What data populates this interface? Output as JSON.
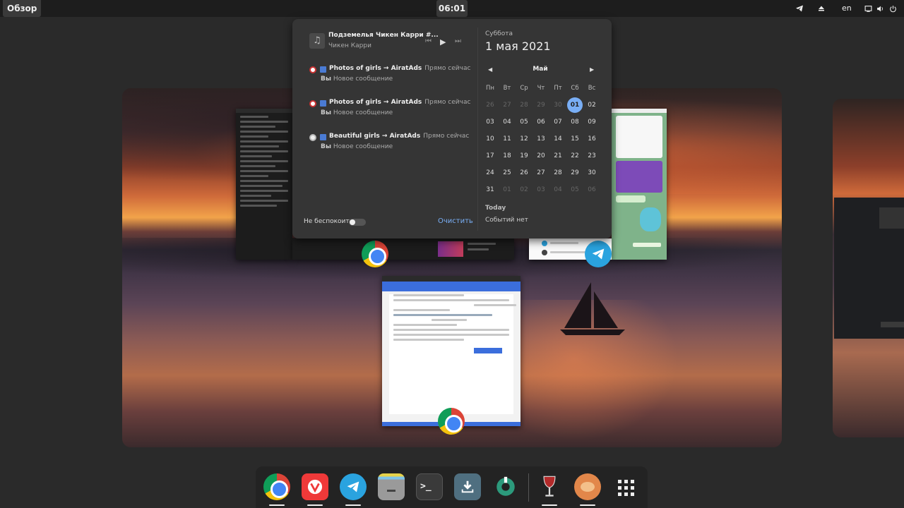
{
  "topbar": {
    "overview_label": "Обзор",
    "clock": "06:01",
    "keyboard_layout": "en"
  },
  "media": {
    "track_title": "Подземелья Чикен Карри #...",
    "artist": "Чикен Карри",
    "prev_icon": "skip-back-icon",
    "play_icon": "play-icon",
    "next_icon": "skip-forward-icon"
  },
  "notifications": [
    {
      "title": "Photos of girls → AiratAds",
      "time": "Прямо сейчас",
      "sender": "Вы",
      "body": "Новое сообщение"
    },
    {
      "title": "Photos of girls → AiratAds",
      "time": "Прямо сейчас",
      "sender": "Вы",
      "body": "Новое сообщение"
    },
    {
      "title": "Beautiful girls → AiratAds",
      "time": "Прямо сейчас",
      "sender": "Вы",
      "body": "Новое сообщение"
    }
  ],
  "dnd_label": "Не беспокоить",
  "clear_label": "Очистить",
  "calendar": {
    "weekday": "Суббота",
    "date": "1 мая 2021",
    "month": "Май",
    "headers": [
      "Пн",
      "Вт",
      "Ср",
      "Чт",
      "Пт",
      "Сб",
      "Вс"
    ],
    "weeks": [
      [
        "26",
        "27",
        "28",
        "29",
        "30",
        "01",
        "02"
      ],
      [
        "03",
        "04",
        "05",
        "06",
        "07",
        "08",
        "09"
      ],
      [
        "10",
        "11",
        "12",
        "13",
        "14",
        "15",
        "16"
      ],
      [
        "17",
        "18",
        "19",
        "20",
        "21",
        "22",
        "23"
      ],
      [
        "24",
        "25",
        "26",
        "27",
        "28",
        "29",
        "30"
      ],
      [
        "31",
        "01",
        "02",
        "03",
        "04",
        "05",
        "06"
      ]
    ],
    "today_label": "Today",
    "no_events": "Событий нет"
  },
  "dock": {
    "items": [
      {
        "name": "chrome",
        "color": "#ffffff",
        "running": true
      },
      {
        "name": "vivaldi",
        "color": "#ef3939",
        "running": true
      },
      {
        "name": "telegram",
        "color": "#2aa3df",
        "running": true
      },
      {
        "name": "files",
        "color": "#8f8f8f",
        "running": false
      },
      {
        "name": "terminal",
        "color": "#3a3a3a",
        "running": false
      },
      {
        "name": "downloader",
        "color": "#4f6f80",
        "running": false
      },
      {
        "name": "settings-tweaks",
        "color": "#2c9a7c",
        "running": false
      },
      {
        "name": "wine",
        "color": "#3b3b3b",
        "running": true
      },
      {
        "name": "lutris",
        "color": "#e2874a",
        "running": true
      }
    ],
    "apps_grid_icon": "grid-icon"
  },
  "colors": {
    "accent": "#79aef5",
    "panel": "#353535",
    "topbar": "#1d1d1d"
  }
}
